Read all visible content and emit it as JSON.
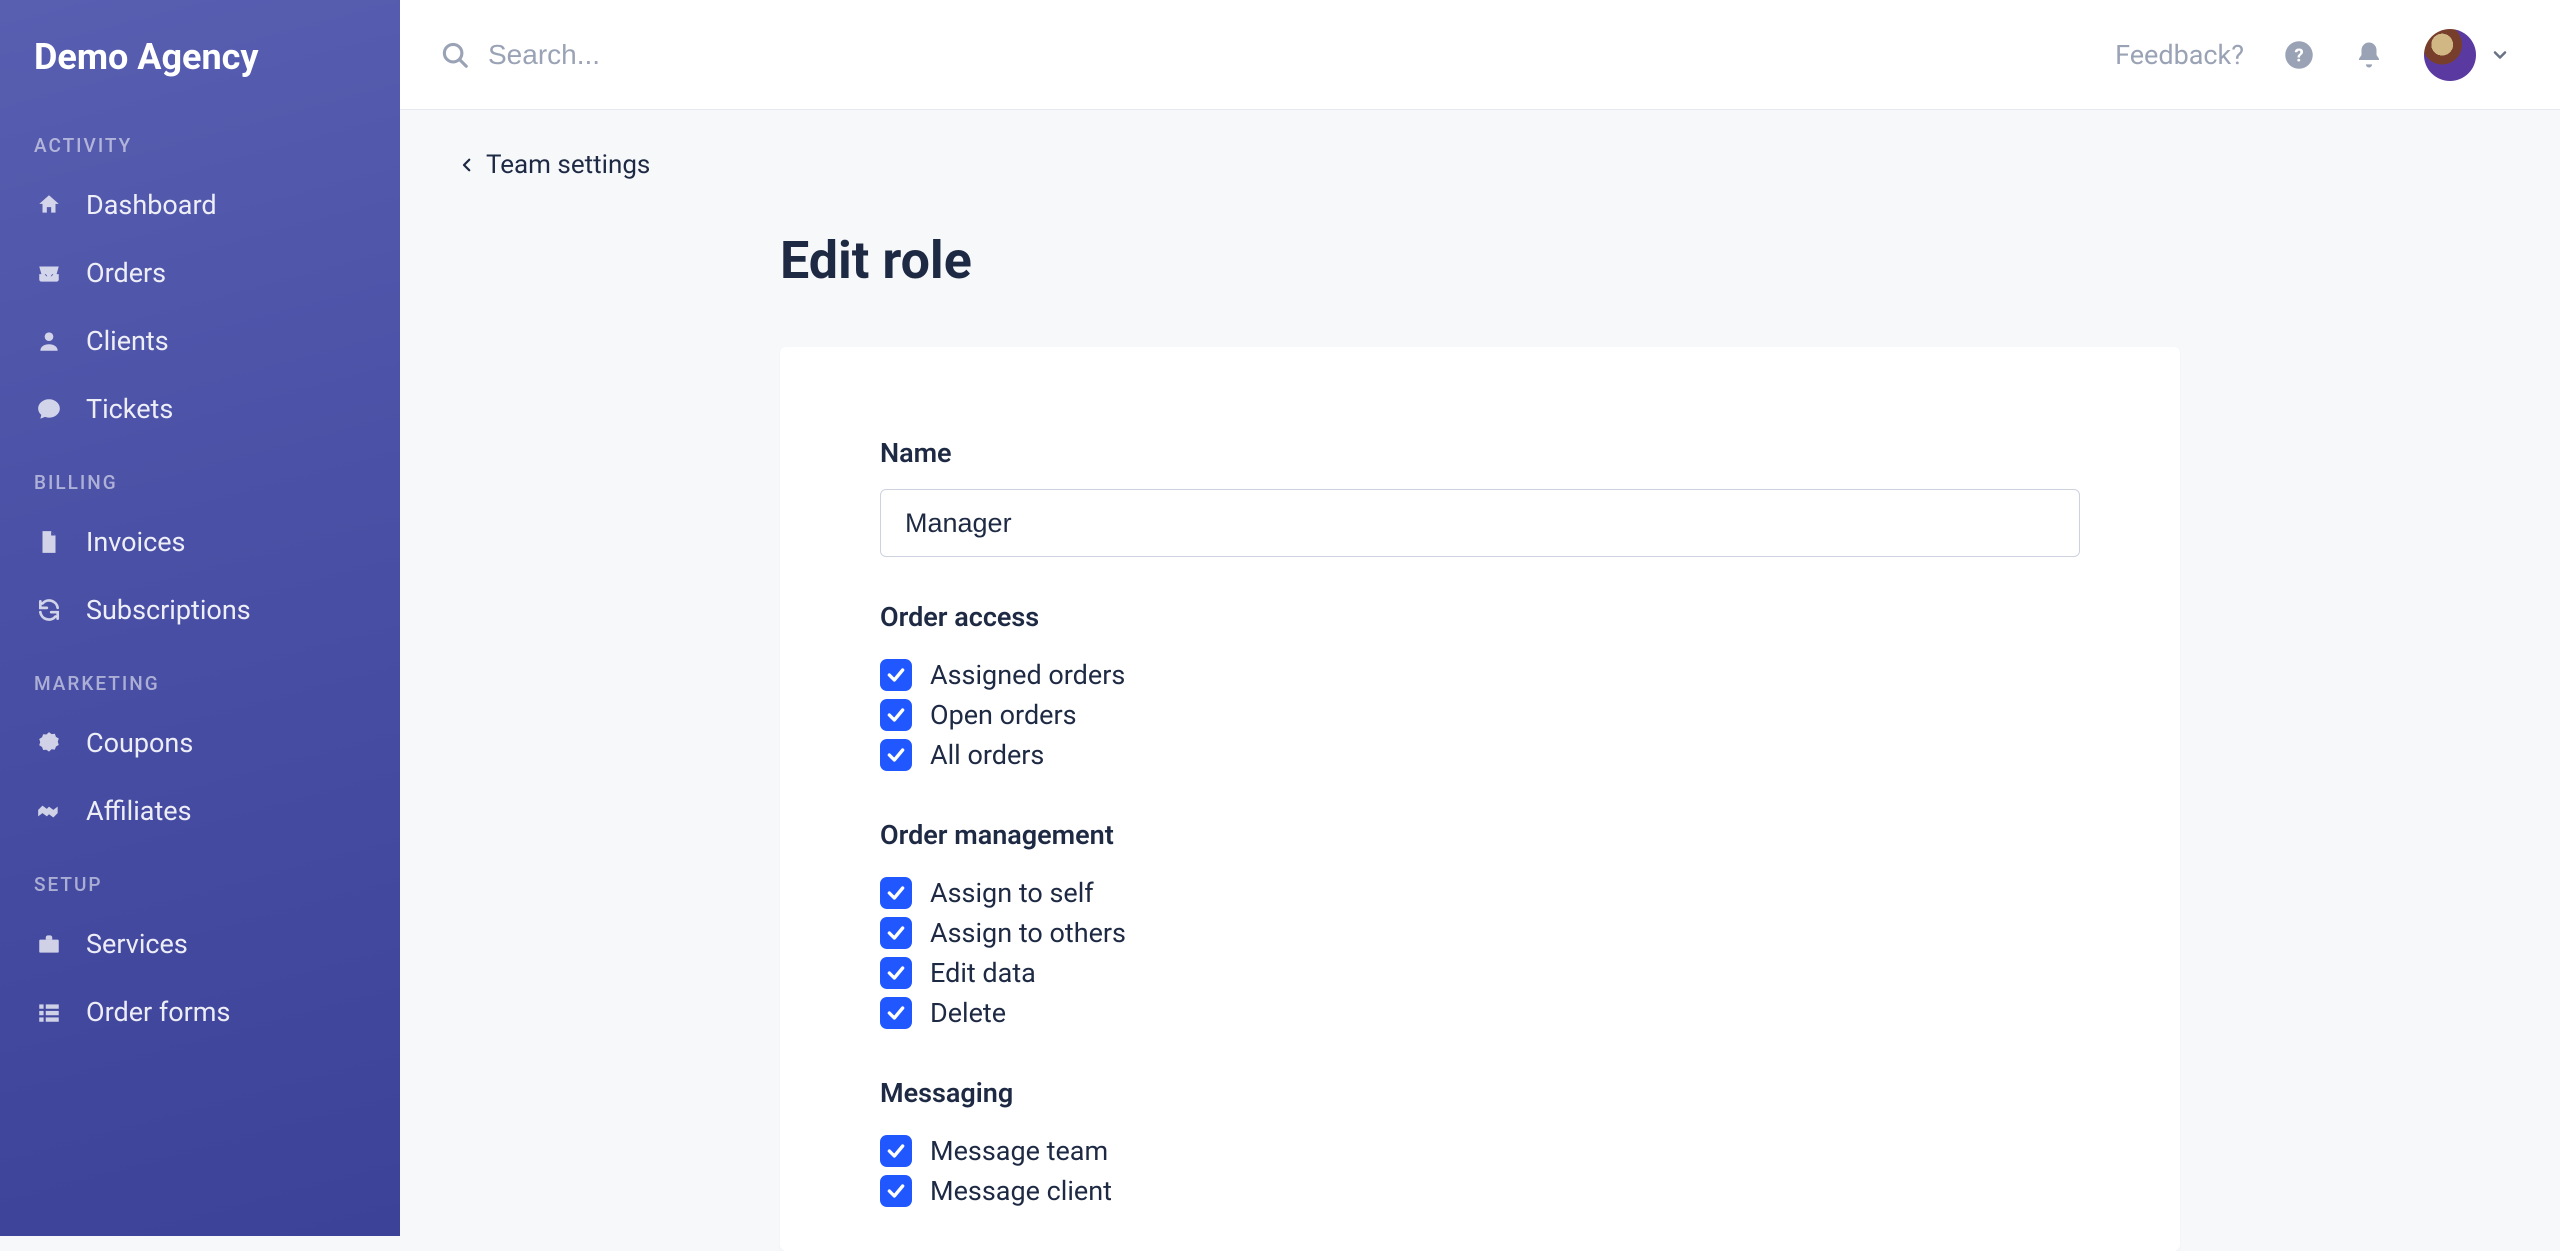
{
  "brand": "Demo Agency",
  "sidebar": {
    "sections": [
      {
        "label": "ACTIVITY",
        "items": [
          {
            "icon": "home",
            "label": "Dashboard",
            "name": "nav-dashboard"
          },
          {
            "icon": "inbox",
            "label": "Orders",
            "name": "nav-orders"
          },
          {
            "icon": "user",
            "label": "Clients",
            "name": "nav-clients"
          },
          {
            "icon": "chat",
            "label": "Tickets",
            "name": "nav-tickets"
          }
        ]
      },
      {
        "label": "BILLING",
        "items": [
          {
            "icon": "file",
            "label": "Invoices",
            "name": "nav-invoices"
          },
          {
            "icon": "refresh",
            "label": "Subscriptions",
            "name": "nav-subscriptions"
          }
        ]
      },
      {
        "label": "MARKETING",
        "items": [
          {
            "icon": "badge",
            "label": "Coupons",
            "name": "nav-coupons"
          },
          {
            "icon": "handshake",
            "label": "Affiliates",
            "name": "nav-affiliates"
          }
        ]
      },
      {
        "label": "SETUP",
        "items": [
          {
            "icon": "briefcase",
            "label": "Services",
            "name": "nav-services"
          },
          {
            "icon": "list",
            "label": "Order forms",
            "name": "nav-order-forms"
          }
        ]
      }
    ]
  },
  "header": {
    "search_placeholder": "Search...",
    "feedback": "Feedback?"
  },
  "breadcrumb": {
    "label": "Team settings"
  },
  "page": {
    "title": "Edit role"
  },
  "form": {
    "name_label": "Name",
    "name_value": "Manager",
    "sections": [
      {
        "heading": "Order access",
        "items": [
          {
            "label": "Assigned orders",
            "checked": true
          },
          {
            "label": "Open orders",
            "checked": true
          },
          {
            "label": "All orders",
            "checked": true
          }
        ]
      },
      {
        "heading": "Order management",
        "items": [
          {
            "label": "Assign to self",
            "checked": true
          },
          {
            "label": "Assign to others",
            "checked": true
          },
          {
            "label": "Edit data",
            "checked": true
          },
          {
            "label": "Delete",
            "checked": true
          }
        ]
      },
      {
        "heading": "Messaging",
        "items": [
          {
            "label": "Message team",
            "checked": true
          },
          {
            "label": "Message client",
            "checked": true
          }
        ]
      }
    ]
  }
}
